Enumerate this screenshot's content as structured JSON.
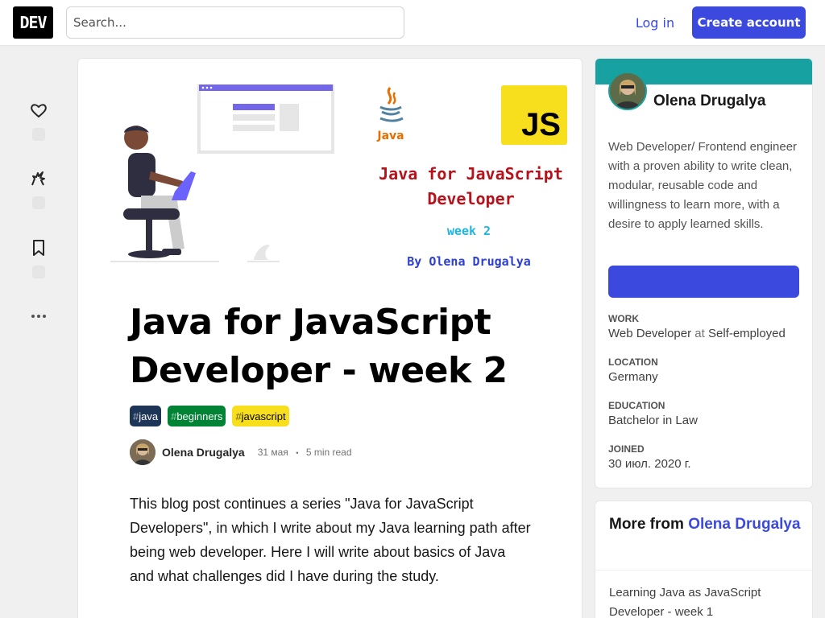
{
  "header": {
    "logo": "DEV",
    "search_placeholder": "Search...",
    "login_label": "Log in",
    "create_account_label": "Create account"
  },
  "colors": {
    "accent": "#3b49df",
    "brand_band": "#17a1a1",
    "tag_java_bg": "#1d3557",
    "tag_beginners_bg": "#008335",
    "tag_javascript_bg": "#f7df1e"
  },
  "reactions": [
    {
      "icon": "heart-icon"
    },
    {
      "icon": "unicorn-icon"
    },
    {
      "icon": "bookmark-icon"
    },
    {
      "icon": "more-horizontal-icon"
    }
  ],
  "cover": {
    "java_label": "Java",
    "js_label": "JS",
    "title": "Java for JavaScript Developer",
    "week": "week 2",
    "by": "By Olena Drugalya"
  },
  "article": {
    "title": "Java for JavaScript Developer - week 2",
    "tags": [
      {
        "hash": "#",
        "name": "java"
      },
      {
        "hash": "#",
        "name": "beginners"
      },
      {
        "hash": "#",
        "name": "javascript"
      }
    ],
    "author": "Olena Drugalya",
    "date": "31 мая",
    "separator": "・",
    "read_time": "5 min read",
    "body": "This blog post continues a series \"Java for JavaScript Developers\", in which I write about my Java learning path after being web developer. Here I will write about basics of Java and what challenges did I have during the study."
  },
  "profile": {
    "name": "Olena Drugalya",
    "bio": "Web Developer/ Frontend engineer with a proven ability to write clean, modular, reusable code and willingness to learn more, with a desire to apply learned skills.",
    "work_label": "Work",
    "work_role": "Web Developer",
    "work_at": "at",
    "work_company": "Self-employed",
    "location_label": "Location",
    "location": "Germany",
    "education_label": "Education",
    "education": "Batchelor in Law",
    "joined_label": "Joined",
    "joined": "30 июл. 2020 г."
  },
  "more_from": {
    "prefix": "More from",
    "author": "Olena Drugalya",
    "items": [
      "Learning Java as JavaScript Developer - week 1"
    ]
  }
}
